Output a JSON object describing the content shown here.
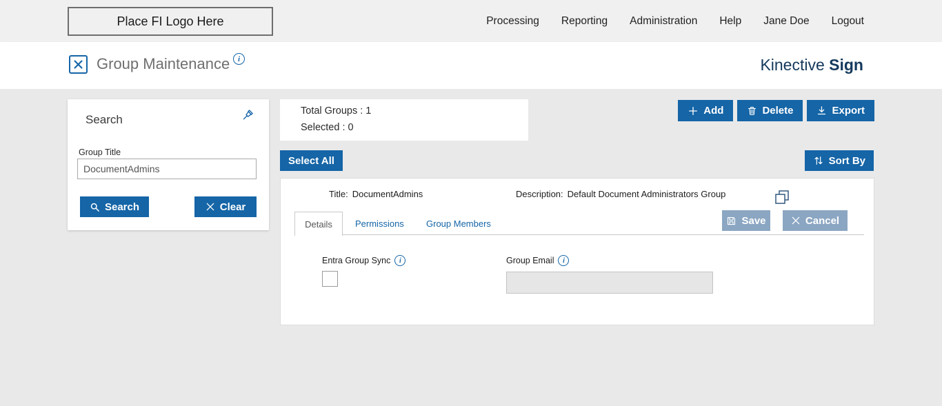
{
  "topbar": {
    "logo": "Place FI Logo Here",
    "nav": [
      {
        "label": "Processing"
      },
      {
        "label": "Reporting"
      },
      {
        "label": "Administration"
      },
      {
        "label": "Help"
      },
      {
        "label": "Jane Doe"
      },
      {
        "label": "Logout"
      }
    ]
  },
  "header": {
    "title": "Group Maintenance",
    "brand_name": "Kinective",
    "brand_product": "Sign"
  },
  "search": {
    "title": "Search",
    "group_title_label": "Group Title",
    "value": "DocumentAdmins",
    "search_label": "Search",
    "clear_label": "Clear"
  },
  "summary": {
    "total": "Total Groups : 1",
    "selected": "Selected : 0"
  },
  "actions": {
    "add": "Add",
    "delete": "Delete",
    "export": "Export",
    "select_all": "Select All",
    "sort_by": "Sort By"
  },
  "group": {
    "title_label": "Title:",
    "title_value": "DocumentAdmins",
    "desc_label": "Description:",
    "desc_value": "Default Document Administrators Group",
    "tabs": [
      {
        "label": "Details"
      },
      {
        "label": "Permissions"
      },
      {
        "label": "Group Members"
      }
    ],
    "save": "Save",
    "cancel": "Cancel",
    "entra_label": "Entra Group Sync",
    "email_label": "Group Email",
    "email_value": ""
  },
  "icons": {
    "maintenance": "crossed-tools-in-square",
    "info": "circled-i",
    "pin": "pushpin-outline",
    "search": "magnifier",
    "clear": "x-mark",
    "add": "plus",
    "delete": "trash-can",
    "export": "download-arrow",
    "sort": "up-down-arrows",
    "save": "floppy-disk",
    "cancel": "x-mark",
    "copy": "overlapping-squares"
  },
  "colors": {
    "primary_blue": "#1565a7",
    "brand_navy": "#14395c",
    "muted_button": "#8ba6c2",
    "topbar_gray": "#f0f0f0",
    "content_gray": "#e9e9e9"
  }
}
